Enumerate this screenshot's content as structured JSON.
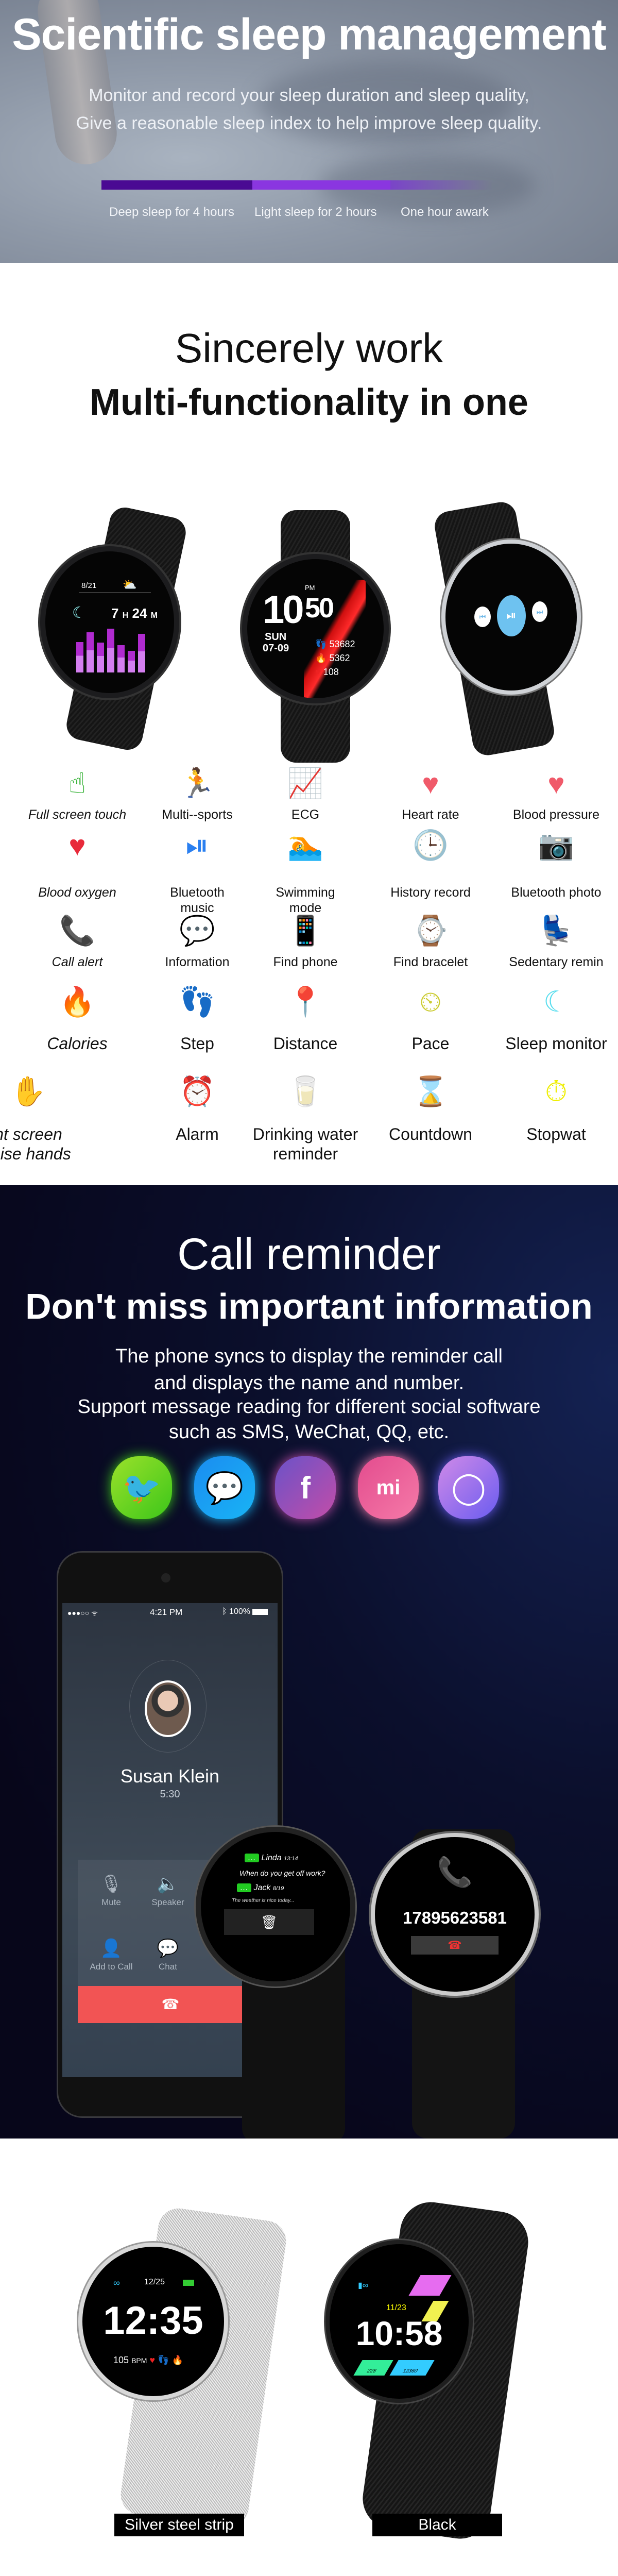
{
  "sleep": {
    "title": "Scientific sleep management",
    "line1": "Monitor and record your sleep duration and sleep quality,",
    "line2": "Give a reasonable sleep index to help improve sleep quality.",
    "segments": [
      {
        "label": "Deep sleep for 4 hours",
        "color": "#4a0a93"
      },
      {
        "label": "Light sleep for 2 hours",
        "color": "#8a36e0"
      },
      {
        "label": "One hour awark",
        "color": "#7a44c8"
      }
    ]
  },
  "multi": {
    "heading1": "Sincerely work",
    "heading2": "Multi-functionality in one",
    "watches": [
      {
        "date": "8/21",
        "sleep_h": "7",
        "h": "H",
        "sleep_m": "24",
        "m": "M"
      },
      {
        "hour": "10",
        "ampm": "PM",
        "minute": "50",
        "day": "SUN",
        "date": "07-09",
        "steps": "53682",
        "calories": "5362",
        "heart": "108"
      },
      {
        "screen": "music-player"
      }
    ],
    "features": [
      {
        "label": "Full screen touch",
        "icon": "touch-icon",
        "italic": true
      },
      {
        "label": "Multi--sports",
        "icon": "running-icon"
      },
      {
        "label": "ECG",
        "icon": "ecg-icon"
      },
      {
        "label": "Heart rate",
        "icon": "heart-rate-icon"
      },
      {
        "label": "Blood pressure",
        "icon": "blood-pressure-icon"
      },
      {
        "label": "Blood oxygen",
        "icon": "blood-oxygen-icon",
        "italic": true
      },
      {
        "label": "Bluetooth",
        "label2": "music",
        "icon": "music-icon"
      },
      {
        "label": "Swimming",
        "label2": "mode",
        "icon": "swimming-icon"
      },
      {
        "label": "History record",
        "icon": "history-icon"
      },
      {
        "label": "Bluetooth photo",
        "icon": "camera-icon"
      },
      {
        "label": "Call alert",
        "icon": "phone-icon",
        "italic": true
      },
      {
        "label": "Information",
        "icon": "message-icon"
      },
      {
        "label": "Find phone",
        "icon": "find-phone-icon"
      },
      {
        "label": "Find bracelet",
        "icon": "find-bracelet-icon"
      },
      {
        "label": "Sedentary remin",
        "icon": "sedentary-icon"
      },
      {
        "label": "Calories",
        "icon": "flame-icon",
        "italic": true
      },
      {
        "label": "Step",
        "icon": "footsteps-icon"
      },
      {
        "label": "Distance",
        "icon": "location-pin-icon"
      },
      {
        "label": "Pace",
        "icon": "speedometer-icon"
      },
      {
        "label": "Sleep monitor",
        "icon": "moon-icon"
      },
      {
        "label": "nt screen",
        "label2": "raise hands",
        "icon": "raise-hand-icon",
        "italic": true
      },
      {
        "label": "Alarm",
        "icon": "alarm-clock-icon"
      },
      {
        "label": "Drinking water",
        "label2": "reminder",
        "icon": "water-glass-icon"
      },
      {
        "label": "Countdown",
        "icon": "hourglass-icon"
      },
      {
        "label": "Stopwat",
        "icon": "stopwatch-icon"
      }
    ]
  },
  "call": {
    "title": "Call reminder",
    "subtitle": "Don't miss important information",
    "para": [
      "The phone syncs to display the reminder call",
      "and displays the name and number.",
      "Support message reading for different social software",
      "such as SMS, WeChat, QQ, etc."
    ],
    "apps": [
      {
        "icon": "twitter-icon",
        "glyph": "🐦",
        "color1": "#9be12a",
        "color2": "#3cc61a"
      },
      {
        "icon": "wechat-icon",
        "glyph": "💬",
        "color1": "#1a8cf0",
        "color2": "#19b4f5"
      },
      {
        "icon": "facebook-icon",
        "glyph": "f",
        "color1": "#6b52c8",
        "color2": "#c24da8"
      },
      {
        "icon": "mi-chat-icon",
        "glyph": "mi",
        "color1": "#e34c8e",
        "color2": "#f57aa8"
      },
      {
        "icon": "chat-bubble-icon",
        "glyph": "◯",
        "color1": "#d08ae8",
        "color2": "#6a5cf0"
      }
    ],
    "phone": {
      "time": "4:21 PM",
      "battery": "100%",
      "caller": "Susan Klein",
      "duration": "5:30",
      "buttons": [
        "Mute",
        "Speaker",
        "Add to Call",
        "Chat"
      ]
    },
    "watch_msg": {
      "msg1_name": "Linda",
      "msg1_time": "13:14",
      "msg1_text": "When do you get off work?",
      "msg2_name": "Jack",
      "msg2_time": "8/19",
      "msg2_text": "The weather is nice today..."
    },
    "watch_call": {
      "number": "17895623581"
    }
  },
  "colors": {
    "silver": {
      "label": "Silver steel strip",
      "date": "12/25",
      "time": "12:35",
      "bpm": "105",
      "bpm_unit": "BPM"
    },
    "black": {
      "label": "Black",
      "date": "11/23",
      "time": "10:58",
      "stat1": "228",
      "stat2": "12360"
    }
  }
}
